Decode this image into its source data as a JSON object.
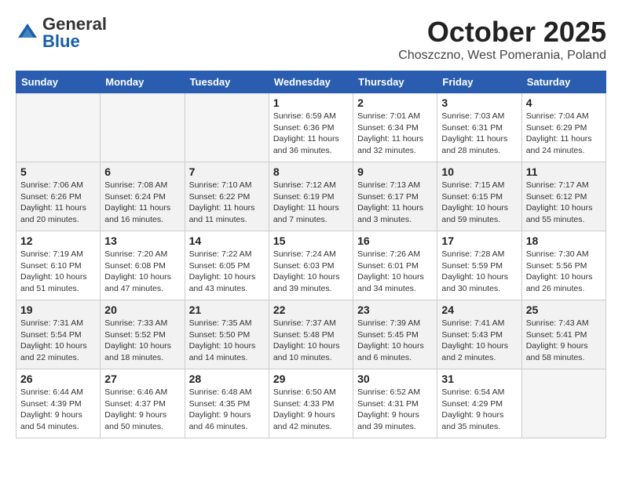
{
  "header": {
    "logo_general": "General",
    "logo_blue": "Blue",
    "month_year": "October 2025",
    "location": "Choszczno, West Pomerania, Poland"
  },
  "weekdays": [
    "Sunday",
    "Monday",
    "Tuesday",
    "Wednesday",
    "Thursday",
    "Friday",
    "Saturday"
  ],
  "weeks": [
    [
      {
        "day": "",
        "empty": true
      },
      {
        "day": "",
        "empty": true
      },
      {
        "day": "",
        "empty": true
      },
      {
        "day": "1",
        "sunrise": "Sunrise: 6:59 AM",
        "sunset": "Sunset: 6:36 PM",
        "daylight": "Daylight: 11 hours and 36 minutes."
      },
      {
        "day": "2",
        "sunrise": "Sunrise: 7:01 AM",
        "sunset": "Sunset: 6:34 PM",
        "daylight": "Daylight: 11 hours and 32 minutes."
      },
      {
        "day": "3",
        "sunrise": "Sunrise: 7:03 AM",
        "sunset": "Sunset: 6:31 PM",
        "daylight": "Daylight: 11 hours and 28 minutes."
      },
      {
        "day": "4",
        "sunrise": "Sunrise: 7:04 AM",
        "sunset": "Sunset: 6:29 PM",
        "daylight": "Daylight: 11 hours and 24 minutes."
      }
    ],
    [
      {
        "day": "5",
        "sunrise": "Sunrise: 7:06 AM",
        "sunset": "Sunset: 6:26 PM",
        "daylight": "Daylight: 11 hours and 20 minutes."
      },
      {
        "day": "6",
        "sunrise": "Sunrise: 7:08 AM",
        "sunset": "Sunset: 6:24 PM",
        "daylight": "Daylight: 11 hours and 16 minutes."
      },
      {
        "day": "7",
        "sunrise": "Sunrise: 7:10 AM",
        "sunset": "Sunset: 6:22 PM",
        "daylight": "Daylight: 11 hours and 11 minutes."
      },
      {
        "day": "8",
        "sunrise": "Sunrise: 7:12 AM",
        "sunset": "Sunset: 6:19 PM",
        "daylight": "Daylight: 11 hours and 7 minutes."
      },
      {
        "day": "9",
        "sunrise": "Sunrise: 7:13 AM",
        "sunset": "Sunset: 6:17 PM",
        "daylight": "Daylight: 11 hours and 3 minutes."
      },
      {
        "day": "10",
        "sunrise": "Sunrise: 7:15 AM",
        "sunset": "Sunset: 6:15 PM",
        "daylight": "Daylight: 10 hours and 59 minutes."
      },
      {
        "day": "11",
        "sunrise": "Sunrise: 7:17 AM",
        "sunset": "Sunset: 6:12 PM",
        "daylight": "Daylight: 10 hours and 55 minutes."
      }
    ],
    [
      {
        "day": "12",
        "sunrise": "Sunrise: 7:19 AM",
        "sunset": "Sunset: 6:10 PM",
        "daylight": "Daylight: 10 hours and 51 minutes."
      },
      {
        "day": "13",
        "sunrise": "Sunrise: 7:20 AM",
        "sunset": "Sunset: 6:08 PM",
        "daylight": "Daylight: 10 hours and 47 minutes."
      },
      {
        "day": "14",
        "sunrise": "Sunrise: 7:22 AM",
        "sunset": "Sunset: 6:05 PM",
        "daylight": "Daylight: 10 hours and 43 minutes."
      },
      {
        "day": "15",
        "sunrise": "Sunrise: 7:24 AM",
        "sunset": "Sunset: 6:03 PM",
        "daylight": "Daylight: 10 hours and 39 minutes."
      },
      {
        "day": "16",
        "sunrise": "Sunrise: 7:26 AM",
        "sunset": "Sunset: 6:01 PM",
        "daylight": "Daylight: 10 hours and 34 minutes."
      },
      {
        "day": "17",
        "sunrise": "Sunrise: 7:28 AM",
        "sunset": "Sunset: 5:59 PM",
        "daylight": "Daylight: 10 hours and 30 minutes."
      },
      {
        "day": "18",
        "sunrise": "Sunrise: 7:30 AM",
        "sunset": "Sunset: 5:56 PM",
        "daylight": "Daylight: 10 hours and 26 minutes."
      }
    ],
    [
      {
        "day": "19",
        "sunrise": "Sunrise: 7:31 AM",
        "sunset": "Sunset: 5:54 PM",
        "daylight": "Daylight: 10 hours and 22 minutes."
      },
      {
        "day": "20",
        "sunrise": "Sunrise: 7:33 AM",
        "sunset": "Sunset: 5:52 PM",
        "daylight": "Daylight: 10 hours and 18 minutes."
      },
      {
        "day": "21",
        "sunrise": "Sunrise: 7:35 AM",
        "sunset": "Sunset: 5:50 PM",
        "daylight": "Daylight: 10 hours and 14 minutes."
      },
      {
        "day": "22",
        "sunrise": "Sunrise: 7:37 AM",
        "sunset": "Sunset: 5:48 PM",
        "daylight": "Daylight: 10 hours and 10 minutes."
      },
      {
        "day": "23",
        "sunrise": "Sunrise: 7:39 AM",
        "sunset": "Sunset: 5:45 PM",
        "daylight": "Daylight: 10 hours and 6 minutes."
      },
      {
        "day": "24",
        "sunrise": "Sunrise: 7:41 AM",
        "sunset": "Sunset: 5:43 PM",
        "daylight": "Daylight: 10 hours and 2 minutes."
      },
      {
        "day": "25",
        "sunrise": "Sunrise: 7:43 AM",
        "sunset": "Sunset: 5:41 PM",
        "daylight": "Daylight: 9 hours and 58 minutes."
      }
    ],
    [
      {
        "day": "26",
        "sunrise": "Sunrise: 6:44 AM",
        "sunset": "Sunset: 4:39 PM",
        "daylight": "Daylight: 9 hours and 54 minutes."
      },
      {
        "day": "27",
        "sunrise": "Sunrise: 6:46 AM",
        "sunset": "Sunset: 4:37 PM",
        "daylight": "Daylight: 9 hours and 50 minutes."
      },
      {
        "day": "28",
        "sunrise": "Sunrise: 6:48 AM",
        "sunset": "Sunset: 4:35 PM",
        "daylight": "Daylight: 9 hours and 46 minutes."
      },
      {
        "day": "29",
        "sunrise": "Sunrise: 6:50 AM",
        "sunset": "Sunset: 4:33 PM",
        "daylight": "Daylight: 9 hours and 42 minutes."
      },
      {
        "day": "30",
        "sunrise": "Sunrise: 6:52 AM",
        "sunset": "Sunset: 4:31 PM",
        "daylight": "Daylight: 9 hours and 39 minutes."
      },
      {
        "day": "31",
        "sunrise": "Sunrise: 6:54 AM",
        "sunset": "Sunset: 4:29 PM",
        "daylight": "Daylight: 9 hours and 35 minutes."
      },
      {
        "day": "",
        "empty": true
      }
    ]
  ]
}
